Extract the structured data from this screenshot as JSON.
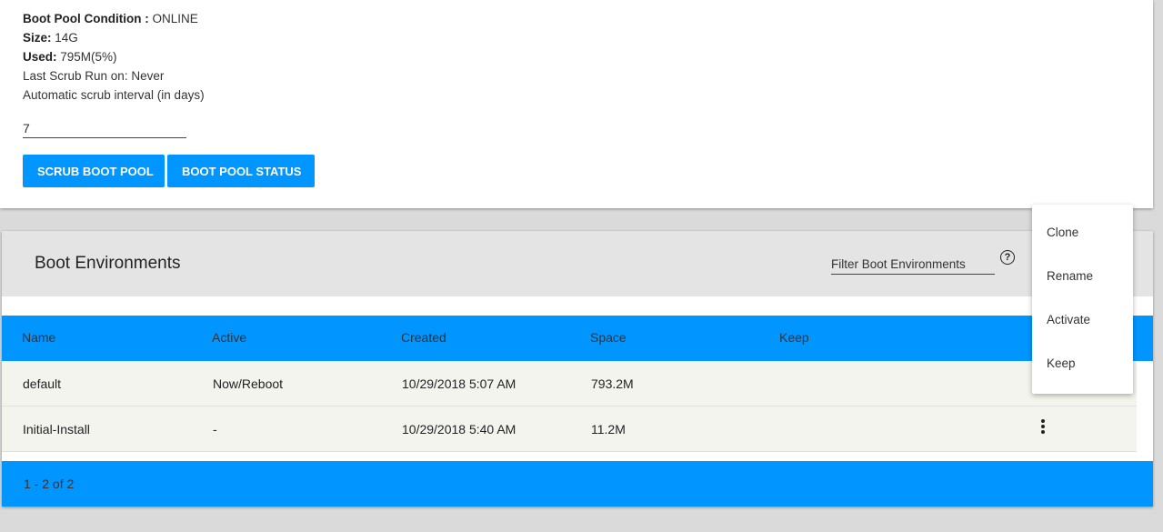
{
  "boot_pool": {
    "condition_label": "Boot Pool Condition :",
    "condition_value": "ONLINE",
    "size_label": "Size:",
    "size_value": "14G",
    "used_label": "Used:",
    "used_value": "795M(5%)",
    "last_scrub": "Last Scrub Run on: Never",
    "interval_label": "Automatic scrub interval (in days)",
    "interval_value": "7",
    "scrub_button": "SCRUB BOOT POOL",
    "status_button": "BOOT POOL STATUS"
  },
  "boot_environments": {
    "title": "Boot Environments",
    "filter_placeholder": "Filter Boot Environments",
    "columns": [
      "Name",
      "Active",
      "Created",
      "Space",
      "Keep"
    ],
    "rows": [
      {
        "name": "default",
        "active": "Now/Reboot",
        "created": "10/29/2018 5:07 AM",
        "space": "793.2M",
        "keep": ""
      },
      {
        "name": "Initial-Install",
        "active": "-",
        "created": "10/29/2018 5:40 AM",
        "space": "11.2M",
        "keep": ""
      }
    ],
    "pagination": "1 - 2 of 2"
  },
  "context_menu": {
    "items": [
      "Clone",
      "Rename",
      "Activate",
      "Keep"
    ]
  },
  "icons": {
    "help": "help-circle-icon",
    "row_menu": "more-vert-icon"
  },
  "colors": {
    "accent": "#0095ff",
    "background": "#dadada",
    "header_bg": "#e4e4e4",
    "row_bg": "#f4f4ee"
  }
}
